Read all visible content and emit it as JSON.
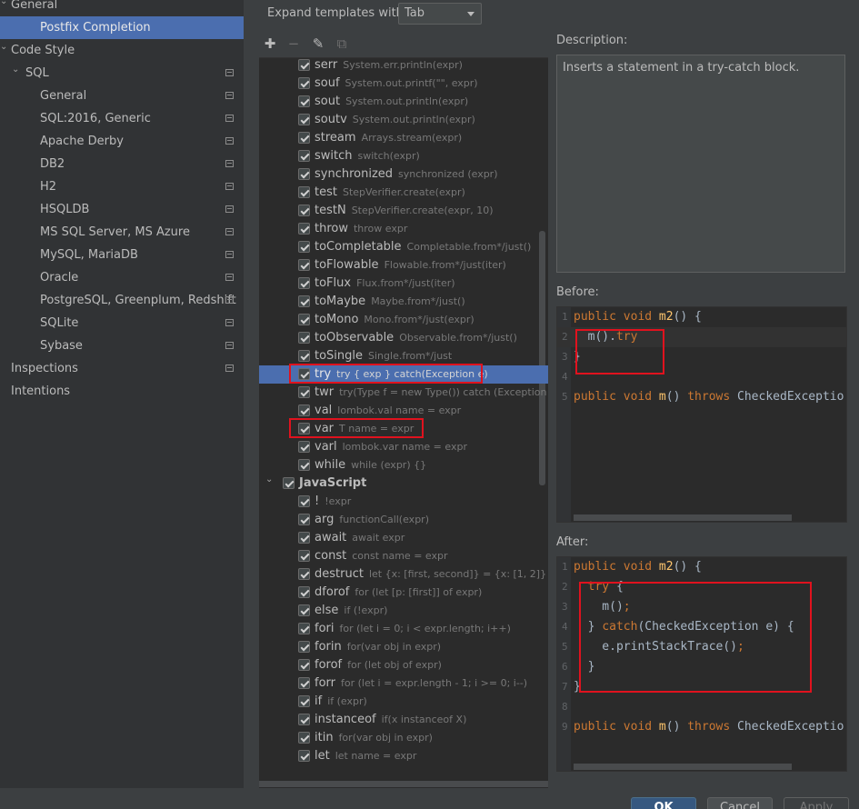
{
  "left_tree": [
    {
      "label": "General",
      "indent": 0,
      "arrow": "expanded"
    },
    {
      "label": "Postfix Completion",
      "indent": 2,
      "selected": true
    },
    {
      "label": "Code Style",
      "indent": 0,
      "arrow": "expanded"
    },
    {
      "label": "SQL",
      "indent": 1,
      "arrow": "expanded",
      "project_icon": true
    },
    {
      "label": "General",
      "indent": 3,
      "project_icon": true
    },
    {
      "label": "SQL:2016, Generic",
      "indent": 3,
      "project_icon": true
    },
    {
      "label": "Apache Derby",
      "indent": 3,
      "project_icon": true
    },
    {
      "label": "DB2",
      "indent": 3,
      "project_icon": true
    },
    {
      "label": "H2",
      "indent": 3,
      "project_icon": true
    },
    {
      "label": "HSQLDB",
      "indent": 3,
      "project_icon": true
    },
    {
      "label": "MS SQL Server, MS Azure",
      "indent": 3,
      "project_icon": true
    },
    {
      "label": "MySQL, MariaDB",
      "indent": 3,
      "project_icon": true
    },
    {
      "label": "Oracle",
      "indent": 3,
      "project_icon": true
    },
    {
      "label": "PostgreSQL, Greenplum, Redshift",
      "indent": 3,
      "project_icon": true
    },
    {
      "label": "SQLite",
      "indent": 3,
      "project_icon": true
    },
    {
      "label": "Sybase",
      "indent": 3,
      "project_icon": true
    },
    {
      "label": "Inspections",
      "indent": 0,
      "project_icon": true
    },
    {
      "label": "Intentions",
      "indent": 0
    }
  ],
  "expand": {
    "label": "Expand templates with",
    "value": "Tab"
  },
  "toolbar": {
    "add": "add-icon",
    "remove": "remove-icon",
    "edit": "edit-icon",
    "copy": "copy-icon"
  },
  "templates": [
    {
      "key": "serr",
      "example": "System.err.println(expr)"
    },
    {
      "key": "souf",
      "example": "System.out.printf(\"\", expr)"
    },
    {
      "key": "sout",
      "example": "System.out.println(expr)"
    },
    {
      "key": "soutv",
      "example": "System.out.println(expr)"
    },
    {
      "key": "stream",
      "example": "Arrays.stream(expr)"
    },
    {
      "key": "switch",
      "example": "switch(expr)"
    },
    {
      "key": "synchronized",
      "example": "synchronized (expr)"
    },
    {
      "key": "test",
      "example": "StepVerifier.create(expr)"
    },
    {
      "key": "testN",
      "example": "StepVerifier.create(expr, 10)"
    },
    {
      "key": "throw",
      "example": "throw expr"
    },
    {
      "key": "toCompletable",
      "example": "Completable.from*/just()"
    },
    {
      "key": "toFlowable",
      "example": "Flowable.from*/just(iter)"
    },
    {
      "key": "toFlux",
      "example": "Flux.from*/just(iter)"
    },
    {
      "key": "toMaybe",
      "example": "Maybe.from*/just()"
    },
    {
      "key": "toMono",
      "example": "Mono.from*/just(expr)"
    },
    {
      "key": "toObservable",
      "example": "Observable.from*/just()"
    },
    {
      "key": "toSingle",
      "example": "Single.from*/just"
    },
    {
      "key": "try",
      "example": "try { exp } catch(Exception e)",
      "selected": true,
      "highlight": true
    },
    {
      "key": "twr",
      "example": "try(Type f = new Type()) catch (Exception e)"
    },
    {
      "key": "val",
      "example": "lombok.val name = expr"
    },
    {
      "key": "var",
      "example": "T name = expr",
      "highlight": true
    },
    {
      "key": "varl",
      "example": "lombok.var name = expr"
    },
    {
      "key": "while",
      "example": "while (expr) {}"
    },
    {
      "group": "JavaScript"
    },
    {
      "key": "!",
      "example": "!expr"
    },
    {
      "key": "arg",
      "example": "functionCall(expr)"
    },
    {
      "key": "await",
      "example": "await expr"
    },
    {
      "key": "const",
      "example": "const name = expr"
    },
    {
      "key": "destruct",
      "example": "let {x: [first, second]} = {x: [1, 2]}"
    },
    {
      "key": "dforof",
      "example": "for (let [p: [first]] of expr)"
    },
    {
      "key": "else",
      "example": "if (!expr)"
    },
    {
      "key": "fori",
      "example": "for (let i = 0; i < expr.length; i++)"
    },
    {
      "key": "forin",
      "example": "for(var obj in expr)"
    },
    {
      "key": "forof",
      "example": "for (let obj of expr)"
    },
    {
      "key": "forr",
      "example": "for (let i = expr.length - 1; i >= 0; i--)"
    },
    {
      "key": "if",
      "example": "if (expr)"
    },
    {
      "key": "instanceof",
      "example": "if(x instanceof X)"
    },
    {
      "key": "itin",
      "example": "for(var obj in expr)"
    },
    {
      "key": "let",
      "example": "let name = expr"
    }
  ],
  "description": {
    "title": "Description:",
    "text": "Inserts a statement in a try-catch block."
  },
  "before": {
    "title": "Before:",
    "lines": [
      {
        "n": "1",
        "html": "<span class=\"kw\">public void </span><span class=\"fn\">m2</span>() {"
      },
      {
        "n": "2",
        "html": "  m().<span class=\"kw\">try</span>",
        "cur": true
      },
      {
        "n": "3",
        "html": "}"
      },
      {
        "n": "4",
        "html": ""
      },
      {
        "n": "5",
        "html": "<span class=\"kw\">public void </span><span class=\"fn\">m</span>() <span class=\"kw\">throws </span>CheckedExceptio"
      }
    ]
  },
  "after": {
    "title": "After:",
    "lines": [
      {
        "n": "1",
        "html": "<span class=\"kw\">public void </span><span class=\"fn\">m2</span>() {"
      },
      {
        "n": "2",
        "html": "  <span class=\"kw\">try </span>{"
      },
      {
        "n": "3",
        "html": "    m()<span class=\"kw\">;</span>"
      },
      {
        "n": "4",
        "html": "  } <span class=\"kw\">catch</span>(CheckedException e) {"
      },
      {
        "n": "5",
        "html": "    e.printStackTrace()<span class=\"kw\">;</span>"
      },
      {
        "n": "6",
        "html": "  }"
      },
      {
        "n": "7",
        "html": "}"
      },
      {
        "n": "8",
        "html": ""
      },
      {
        "n": "9",
        "html": "<span class=\"kw\">public void </span><span class=\"fn\">m</span>() <span class=\"kw\">throws </span>CheckedExceptio"
      }
    ]
  },
  "buttons": {
    "ok": "OK",
    "cancel": "Cancel",
    "apply": "Apply"
  },
  "colors": {
    "selection": "#4b6eaf",
    "highlight_box": "#e0121e",
    "keyword": "#cc7832"
  }
}
